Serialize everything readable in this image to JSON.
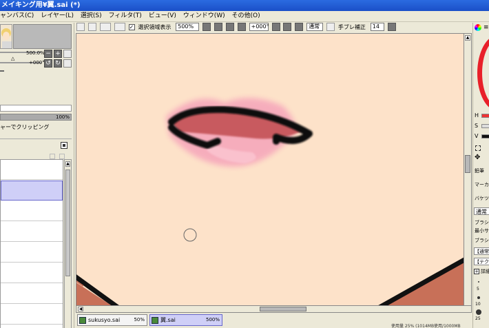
{
  "window": {
    "title": "メイキング用¥翼.sai (*)"
  },
  "menu": [
    "ャンバス(C)",
    "レイヤー(L)",
    "選択(S)",
    "フィルタ(T)",
    "ビュー(V)",
    "ウィンドウ(W)",
    "その他(O)"
  ],
  "navigator": {
    "zoom": "500.0%",
    "angle": "+000°"
  },
  "layers": {
    "opacity": "100%",
    "clip_label": "ャーでクリッピング"
  },
  "toolbar": {
    "selection_label": "選択領域表示",
    "zoom_value": "500%",
    "angle_value": "+000°",
    "blend_mode": "通常",
    "stabilizer_label": "手ブレ補正",
    "stabilizer_value": "14"
  },
  "tabs": [
    {
      "name": "sukusyo.sai",
      "zoom": "50%"
    },
    {
      "name": "翼.sai",
      "zoom": "500%"
    }
  ],
  "right_panel": {
    "h_label": "H",
    "s_label": "S",
    "v_label": "V",
    "tool_pen": "鉛筆",
    "tool_marker": "マーカー",
    "tool_bucket": "バケツ",
    "blend": "通常",
    "brush_size_label": "ブラシサ",
    "min_size_label": "最小サ",
    "brush_density_label": "ブラシ濃",
    "normal_label": "【通常",
    "texture_label": "【テクス",
    "detail_label": "詳細",
    "size_5": "5",
    "size_10": "10",
    "size_25": "25"
  },
  "status": {
    "memory_text": "使用量 25% (1014MB使用/1000MB"
  }
}
